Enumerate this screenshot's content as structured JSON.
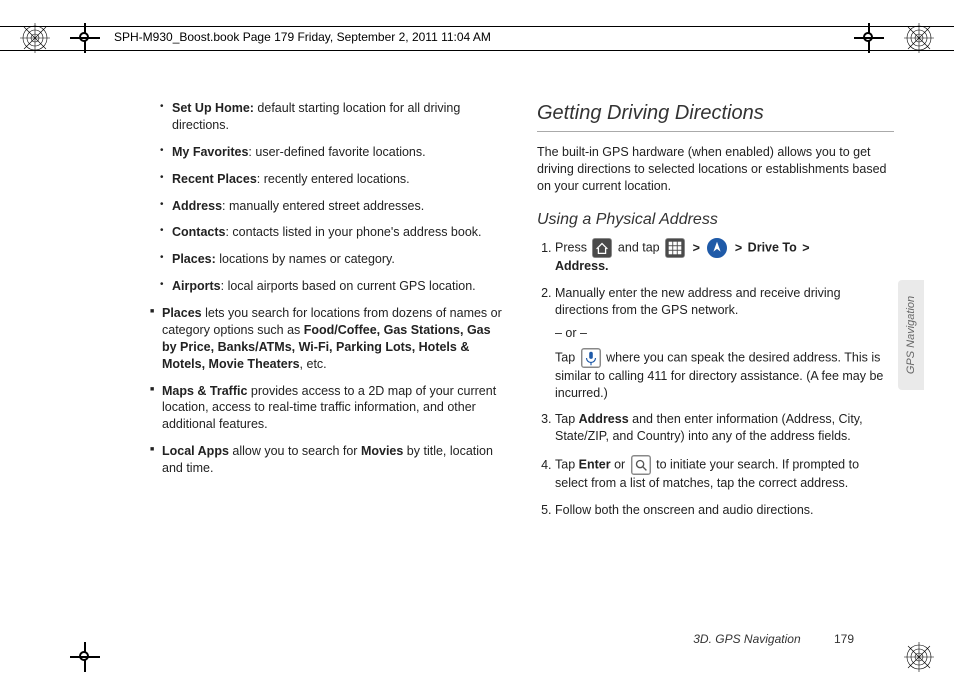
{
  "header": {
    "text": "SPH-M930_Boost.book  Page 179  Friday, September 2, 2011  11:04 AM"
  },
  "left_col": {
    "bullets": [
      {
        "term": "Set Up Home:",
        "desc": " default starting location for all driving directions."
      },
      {
        "term": "My Favorites",
        "desc": ": user-defined favorite locations."
      },
      {
        "term": "Recent Places",
        "desc": ": recently entered locations."
      },
      {
        "term": "Address",
        "desc": ": manually entered street addresses."
      },
      {
        "term": "Contacts",
        "desc": ": contacts listed in your phone's address book."
      },
      {
        "term": "Places:",
        "desc": " locations by names or category."
      },
      {
        "term": "Airports",
        "desc": ": local airports based on current GPS location."
      }
    ],
    "squares": [
      {
        "lead": "Places",
        "rest_a": " lets you search for locations from dozens of names or category options such as ",
        "bold_mid": "Food/Coffee, Gas Stations, Gas by Price, Banks/ATMs, Wi-Fi, Parking Lots, Hotels & Motels, Movie Theaters",
        "rest_b": ", etc."
      },
      {
        "lead": "Maps & Traffic",
        "rest_a": " provides access to a 2D map of your current location, access to real-time traffic information, and other additional features.",
        "bold_mid": "",
        "rest_b": ""
      },
      {
        "lead": "Local Apps",
        "rest_a": " allow you to search for ",
        "bold_mid": "Movies",
        "rest_b": " by title, location and time."
      }
    ]
  },
  "right_col": {
    "h2": "Getting Driving Directions",
    "intro": "The built-in GPS hardware (when enabled) allows you to get driving directions to selected locations or establishments based on your current location.",
    "h3": "Using a Physical Address",
    "step1_a": "Press ",
    "step1_b": " and tap ",
    "step1_drive": "Drive To",
    "step1_addr": "Address.",
    "step2": "Manually enter the new address and receive driving directions from the GPS network.",
    "or": "– or –",
    "step2b_a": "Tap ",
    "step2b_b": " where you can speak the desired address. This is similar to calling 411 for directory assistance. (A fee may be incurred.)",
    "step3_a": "Tap ",
    "step3_bold": "Address",
    "step3_b": " and then enter information (Address, City, State/ZIP, and Country) into any of the address fields.",
    "step4_a": "Tap ",
    "step4_bold": "Enter",
    "step4_b": " or ",
    "step4_c": " to initiate your search. If prompted to select from a list of matches, tap the correct address.",
    "step5": "Follow both the onscreen and audio directions."
  },
  "side_tab": "GPS Navigation",
  "footer": {
    "section": "3D. GPS Navigation",
    "page": "179"
  }
}
